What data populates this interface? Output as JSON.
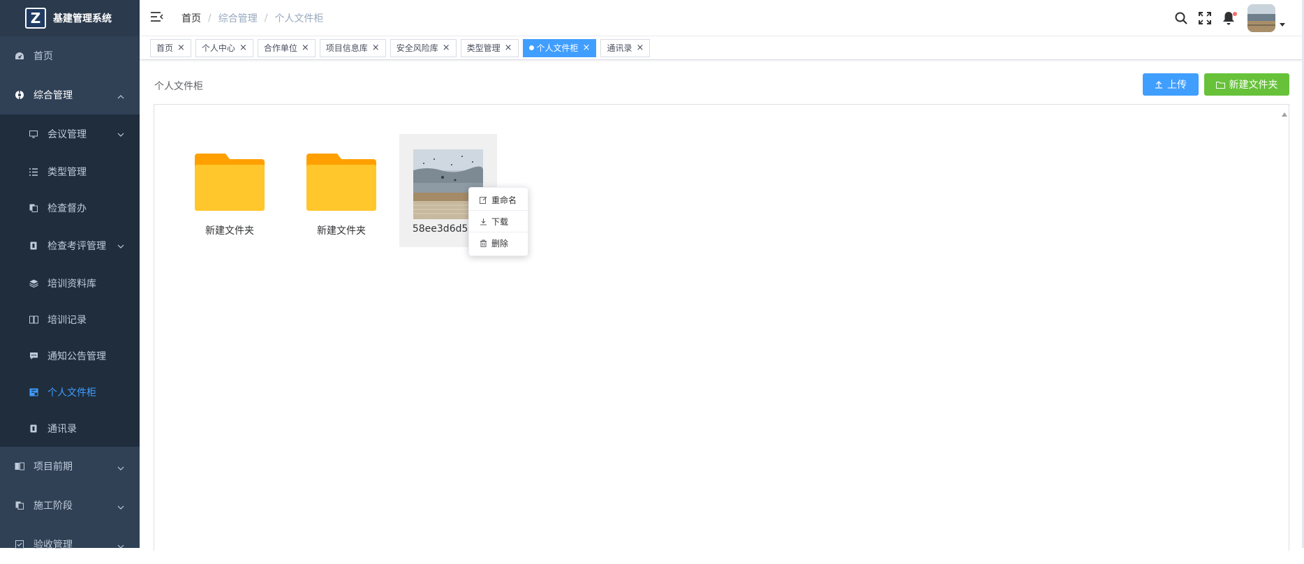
{
  "app": {
    "title": "基建管理系统",
    "logo_letter": "Z"
  },
  "sidebar": {
    "items": [
      {
        "label": "首页",
        "icon": "dashboard-icon"
      },
      {
        "label": "综合管理",
        "icon": "gear-icon",
        "expanded": true
      },
      {
        "label": "项目前期",
        "icon": "book-icon"
      },
      {
        "label": "施工阶段",
        "icon": "documents-icon"
      },
      {
        "label": "验收管理",
        "icon": "checkbox-icon"
      }
    ],
    "sub_items": [
      {
        "label": "会议管理",
        "icon": "monitor-icon"
      },
      {
        "label": "类型管理",
        "icon": "list-icon"
      },
      {
        "label": "检查督办",
        "icon": "documents-icon"
      },
      {
        "label": "检查考评管理",
        "icon": "contact-card-icon"
      },
      {
        "label": "培训资料库",
        "icon": "layers-icon"
      },
      {
        "label": "培训记录",
        "icon": "book-icon"
      },
      {
        "label": "通知公告管理",
        "icon": "chat-icon"
      },
      {
        "label": "个人文件柜",
        "icon": "file-cabinet-icon",
        "active": true
      },
      {
        "label": "通讯录",
        "icon": "contact-card-icon"
      }
    ]
  },
  "breadcrumb": {
    "items": [
      "首页",
      "综合管理",
      "个人文件柜"
    ],
    "separator": "/"
  },
  "tags": [
    {
      "label": "首页",
      "active": false
    },
    {
      "label": "个人中心",
      "active": false
    },
    {
      "label": "合作单位",
      "active": false
    },
    {
      "label": "项目信息库",
      "active": false
    },
    {
      "label": "安全风险库",
      "active": false
    },
    {
      "label": "类型管理",
      "active": false
    },
    {
      "label": "个人文件柜",
      "active": true
    },
    {
      "label": "通讯录",
      "active": false
    }
  ],
  "main": {
    "title": "个人文件柜",
    "upload_label": "上传",
    "new_folder_label": "新建文件夹",
    "files": [
      {
        "name": "新建文件夹",
        "type": "folder"
      },
      {
        "name": "新建文件夹",
        "type": "folder"
      },
      {
        "name": "58ee3d6d55fb",
        "type": "image",
        "selected": true
      }
    ]
  },
  "context_menu": {
    "items": [
      {
        "label": "重命名",
        "icon": "edit-icon"
      },
      {
        "label": "下载",
        "icon": "download-icon"
      },
      {
        "label": "删除",
        "icon": "trash-icon"
      }
    ]
  },
  "colors": {
    "sidebar_bg": "#304156",
    "submenu_bg": "#1f2d3d",
    "accent": "#409eff",
    "success": "#67c23a",
    "folder": "#ffc72c"
  }
}
